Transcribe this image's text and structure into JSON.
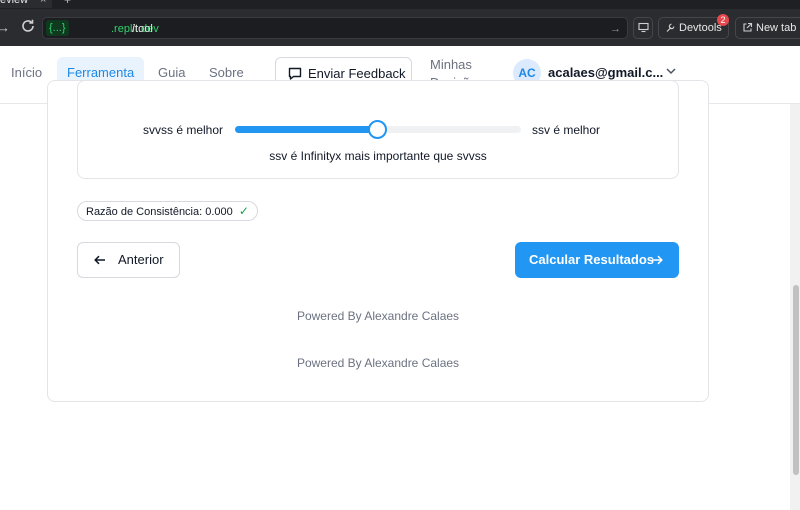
{
  "browser": {
    "tab_title": "eview",
    "tab_close": "×",
    "tab_add": "+",
    "url_host_badge": "{...}",
    "url_host_rest": ".replit.dev",
    "url_path": "/tool",
    "devtools_label": "Devtools",
    "devtools_badge": "2",
    "newtab_label": "New tab"
  },
  "nav": {
    "items": [
      {
        "label": "Início"
      },
      {
        "label": "Ferramenta",
        "active": true
      },
      {
        "label": "Guia"
      },
      {
        "label": "Sobre"
      }
    ],
    "feedback_label": "Enviar Feedback",
    "minhas_line1": "Minhas",
    "minhas_line2": "Decisões",
    "avatar_initials": "AC",
    "user_email": "acalaes@gmail.c..."
  },
  "comparison": {
    "left_label": "svvss é melhor",
    "right_label": "ssv é melhor",
    "slider_value": 0.5,
    "caption": "ssv é Infinityx mais importante que svvss"
  },
  "consistency": {
    "label": "Razão de Consistência: 0.000",
    "check": "✓"
  },
  "actions": {
    "previous_label": "Anterior",
    "calculate_label": "Calcular Resultados"
  },
  "footer": {
    "powered_1": "Powered By Alexandre Calaes",
    "powered_2": "Powered By Alexandre Calaes"
  },
  "colors": {
    "accent": "#2196f3",
    "success": "#16a34a",
    "url_green": "#2fd36b"
  }
}
